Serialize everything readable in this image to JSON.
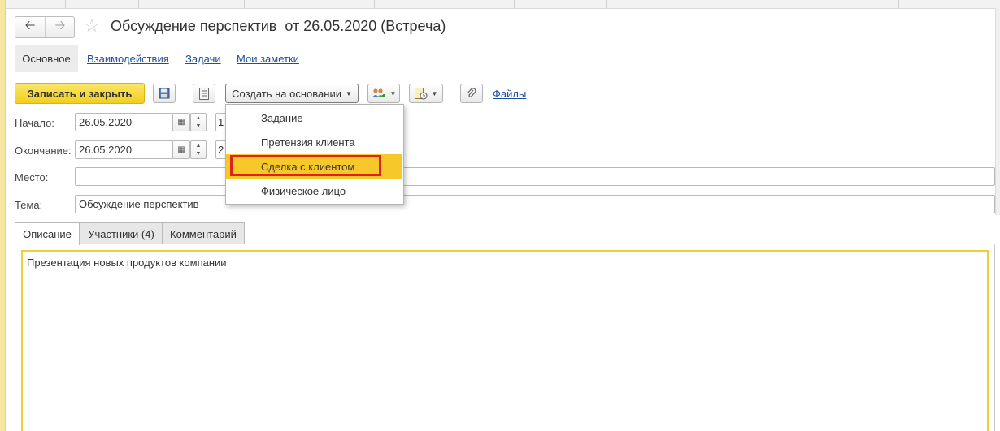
{
  "window": {
    "title": "Обсуждение перспектив  от 26.05.2020 (Встреча)"
  },
  "icons": {
    "back": "arrow-left-icon",
    "forward": "arrow-right-icon",
    "favorite": "star-icon",
    "save": "floppy-disk-icon",
    "report": "document-list-icon",
    "participants": "people-add-icon",
    "schedule": "document-clock-icon",
    "attach": "paperclip-icon",
    "calendar": "calendar-icon"
  },
  "section_tabs": [
    {
      "label": "Основное"
    },
    {
      "label": "Взаимодействия"
    },
    {
      "label": "Задачи"
    },
    {
      "label": "Мои заметки"
    }
  ],
  "toolbar": {
    "save_close_label": "Записать и закрыть",
    "create_based_label": "Создать на основании",
    "files_label": "Файлы"
  },
  "create_based_menu": {
    "items": [
      {
        "label": "Задание"
      },
      {
        "label": "Претензия клиента"
      },
      {
        "label": "Сделка с клиентом",
        "highlighted": true
      },
      {
        "label": "Физическое лицо"
      }
    ]
  },
  "form": {
    "start_label": "Начало:",
    "start_date": "26.05.2020",
    "start_time_partial": "1",
    "end_label": "Окончание:",
    "end_date": "26.05.2020",
    "end_time_partial": "2",
    "place_label": "Место:",
    "place_value": "",
    "subject_label": "Тема:",
    "subject_value": "Обсуждение перспектив"
  },
  "content_tabs": [
    {
      "label": "Описание"
    },
    {
      "label": "Участники (4)"
    },
    {
      "label": "Комментарий"
    }
  ],
  "description": {
    "text": "Презентация новых продуктов компании"
  },
  "colors": {
    "primary_button": "#f2cf1d",
    "link": "#1d4f9e",
    "menu_highlight": "#f6c82a",
    "highlight_frame": "#e0201a",
    "focus_frame": "#f1cf34"
  }
}
